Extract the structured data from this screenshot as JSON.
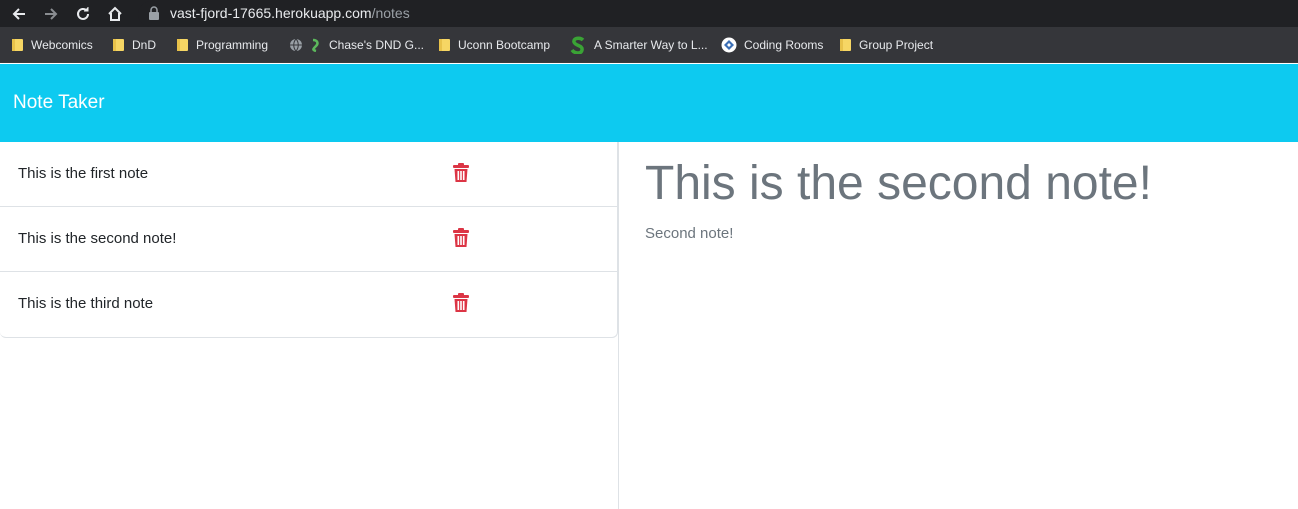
{
  "browser": {
    "url_host": "vast-fjord-17665.herokuapp.com",
    "url_path": "/notes",
    "bookmarks": [
      {
        "label": "Webcomics",
        "icon": "folder-icon"
      },
      {
        "label": "DnD",
        "icon": "folder-icon"
      },
      {
        "label": "Programming",
        "icon": "folder-icon"
      },
      {
        "label": "Chase's DND G...",
        "icon": "dragon-icon"
      },
      {
        "label": "Uconn Bootcamp",
        "icon": "folder-icon"
      },
      {
        "label": "A Smarter Way to L...",
        "icon": "s-logo-icon"
      },
      {
        "label": "Coding Rooms",
        "icon": "coding-rooms-icon"
      },
      {
        "label": "Group Project",
        "icon": "folder-icon"
      }
    ]
  },
  "app": {
    "title": "Note Taker",
    "accent_color": "#0dcaf0",
    "delete_color": "#dc3545"
  },
  "notes": [
    {
      "title": "This is the first note"
    },
    {
      "title": "This is the second note!"
    },
    {
      "title": "This is the third note"
    }
  ],
  "active_note": {
    "title": "This is the second note!",
    "text": "Second note!"
  }
}
